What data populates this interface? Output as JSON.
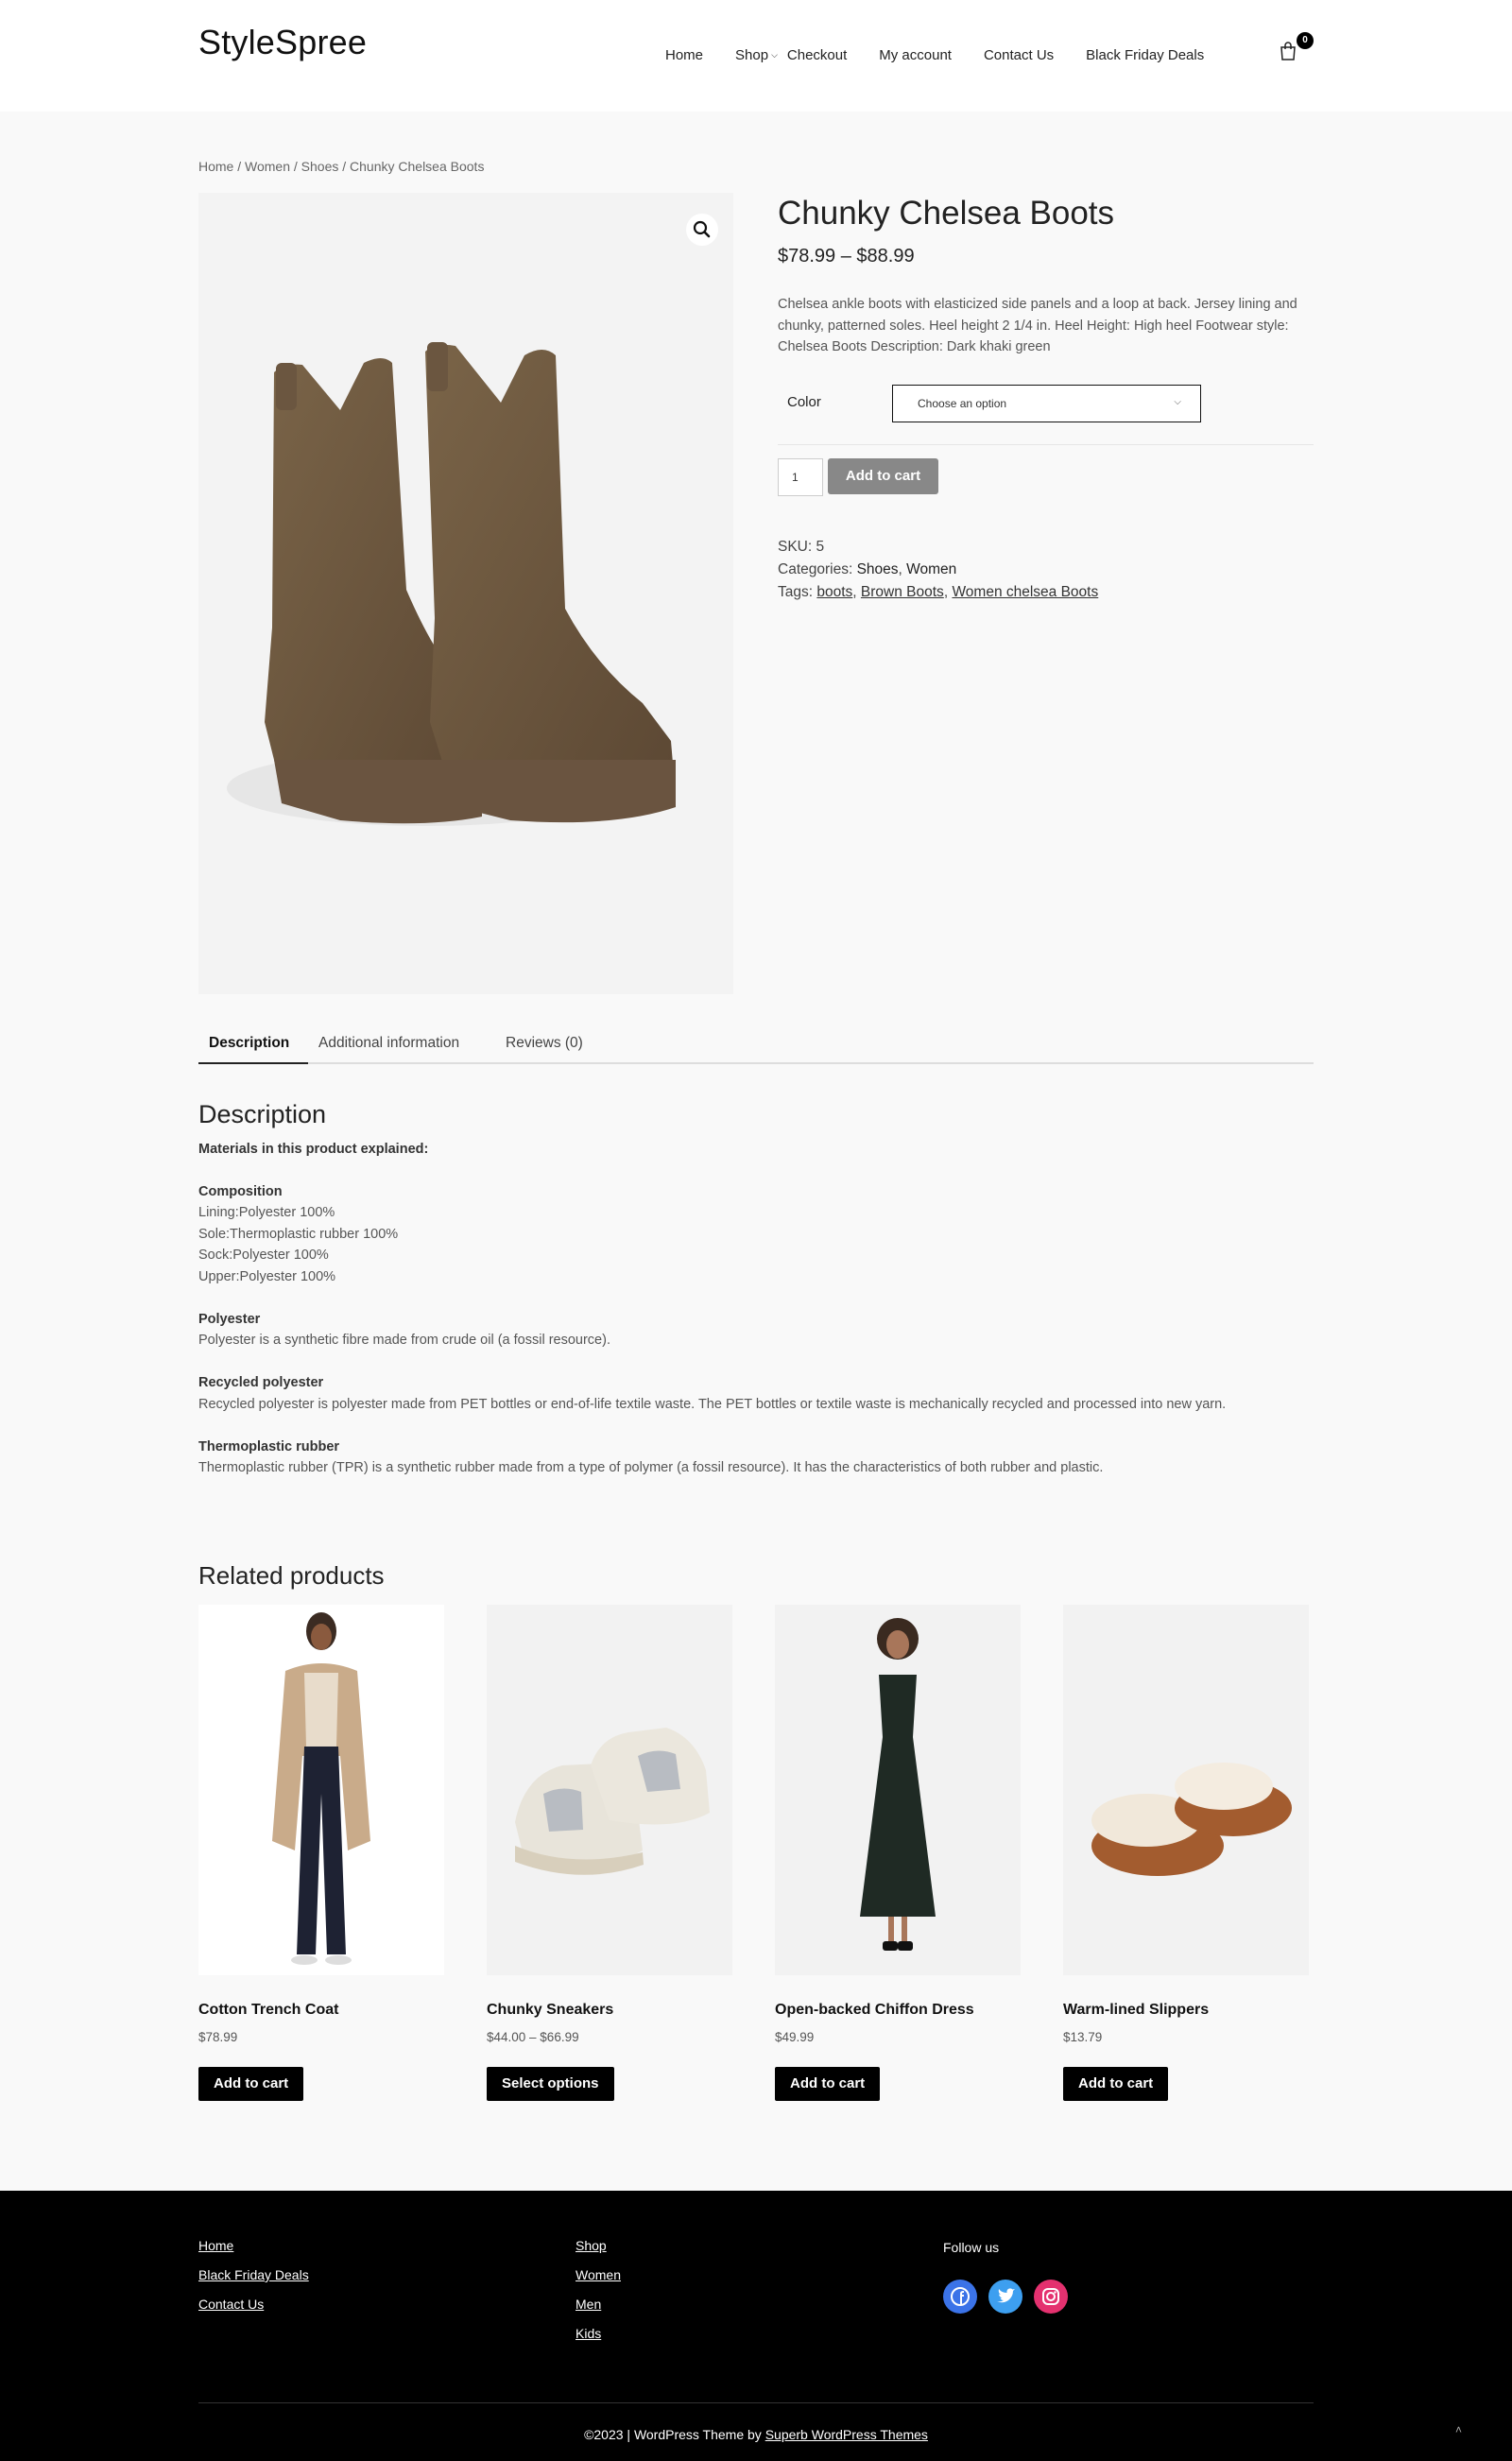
{
  "site": {
    "logo": "StyleSpree"
  },
  "nav": {
    "items": [
      {
        "label": "Home"
      },
      {
        "label": "Shop"
      },
      {
        "label": "Checkout"
      },
      {
        "label": "My account"
      },
      {
        "label": "Contact Us"
      },
      {
        "label": "Black Friday Deals"
      }
    ],
    "cart_count": "0"
  },
  "breadcrumb": "Home / Women / Shoes / Chunky Chelsea Boots",
  "product": {
    "title": "Chunky Chelsea Boots",
    "price": "$78.99 – $88.99",
    "short_description": "Chelsea ankle boots with elasticized side panels and a loop at back. Jersey lining and chunky, patterned soles. Heel height 2 1/4 in. Heel Height: High heel Footwear style: Chelsea Boots Description: Dark khaki green",
    "variation_label": "Color",
    "variation_placeholder": "Choose an option",
    "quantity": "1",
    "add_to_cart": "Add to cart",
    "sku_label": "SKU:",
    "sku": "5",
    "categories_label": "Categories:",
    "categories": [
      "Shoes",
      "Women"
    ],
    "tags_label": "Tags:",
    "tags": [
      "boots",
      "Brown Boots",
      "Women chelsea Boots"
    ]
  },
  "tabs": [
    {
      "label": "Description"
    },
    {
      "label": "Additional information"
    },
    {
      "label": "Reviews (0)"
    }
  ],
  "description": {
    "heading": "Description",
    "intro": "Materials in this product explained:",
    "composition_title": "Composition",
    "composition": [
      "Lining:Polyester 100%",
      "Sole:Thermoplastic rubber 100%",
      "Sock:Polyester 100%",
      "Upper:Polyester 100%"
    ],
    "sections": [
      {
        "title": "Polyester",
        "text": "Polyester is a synthetic fibre made from crude oil (a fossil resource)."
      },
      {
        "title": "Recycled polyester",
        "text": "Recycled polyester is polyester made from PET bottles or end-of-life textile waste. The PET bottles or textile waste is mechanically recycled and processed into new yarn."
      },
      {
        "title": "Thermoplastic rubber",
        "text": "Thermoplastic rubber (TPR) is a synthetic rubber made from a type of polymer (a fossil resource). It has the characteristics of both rubber and plastic."
      }
    ]
  },
  "related": {
    "title": "Related products",
    "products": [
      {
        "name": "Cotton Trench Coat",
        "price": "$78.99",
        "button": "Add to cart"
      },
      {
        "name": "Chunky Sneakers",
        "price": "$44.00 – $66.99",
        "button": "Select options"
      },
      {
        "name": "Open-backed Chiffon Dress",
        "price": "$49.99",
        "button": "Add to cart"
      },
      {
        "name": "Warm-lined Slippers",
        "price": "$13.79",
        "button": "Add to cart"
      }
    ]
  },
  "footer": {
    "col1": [
      "Home",
      "Black Friday Deals",
      "Contact Us"
    ],
    "col2": [
      "Shop",
      "Women",
      "Men",
      "Kids"
    ],
    "follow_label": "Follow us",
    "social": [
      {
        "icon": "facebook-icon",
        "color": "#3b73e8"
      },
      {
        "icon": "twitter-icon",
        "color": "#3d9ff0"
      },
      {
        "icon": "instagram-icon",
        "color": "#e4316f"
      }
    ],
    "credit_prefix": "©2023 | WordPress Theme by ",
    "credit_link": "Superb WordPress Themes"
  }
}
